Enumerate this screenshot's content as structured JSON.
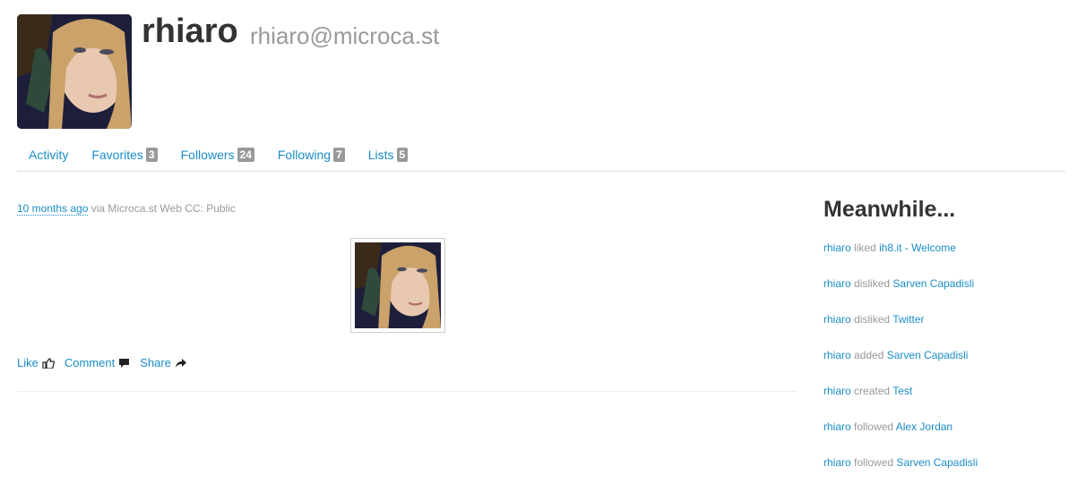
{
  "profile": {
    "name": "rhiaro",
    "webfinger": "rhiaro@microca.st"
  },
  "tabs": [
    {
      "label": "Activity",
      "count": null
    },
    {
      "label": "Favorites",
      "count": "3"
    },
    {
      "label": "Followers",
      "count": "24"
    },
    {
      "label": "Following",
      "count": "7"
    },
    {
      "label": "Lists",
      "count": "5"
    }
  ],
  "activity": {
    "time": "10 months ago",
    "meta": " via Microca.st Web CC: Public",
    "actions": {
      "like": "Like",
      "comment": "Comment",
      "share": "Share"
    },
    "icons": {
      "like": "thumbs-up-icon",
      "comment": "speech-bubble-icon",
      "share": "share-arrow-icon"
    }
  },
  "sidebar": {
    "title": "Meanwhile...",
    "items": [
      {
        "actor": "rhiaro",
        "verb": "liked",
        "object": "ih8.it - Welcome"
      },
      {
        "actor": "rhiaro",
        "verb": "disliked",
        "object": "Sarven Capadisli"
      },
      {
        "actor": "rhiaro",
        "verb": "disliked",
        "object": "Twitter"
      },
      {
        "actor": "rhiaro",
        "verb": "added",
        "object": "Sarven Capadisli"
      },
      {
        "actor": "rhiaro",
        "verb": "created",
        "object": "Test"
      },
      {
        "actor": "rhiaro",
        "verb": "followed",
        "object": "Alex Jordan"
      },
      {
        "actor": "rhiaro",
        "verb": "followed",
        "object": "Sarven Capadisli"
      }
    ]
  },
  "colors": {
    "link": "#1a8dc7",
    "muted": "#999999",
    "badge": "#999999"
  }
}
